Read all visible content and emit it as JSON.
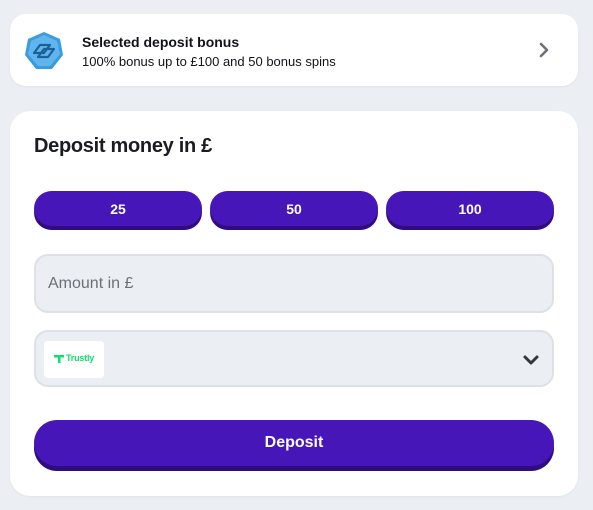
{
  "bonus": {
    "title": "Selected deposit bonus",
    "description": "100% bonus up to £100 and 50 bonus spins",
    "icon": "bonus-ticket-icon",
    "chevron_icon": "chevron-right-icon"
  },
  "deposit": {
    "title": "Deposit money in £",
    "quick_amounts": [
      "25",
      "50",
      "100"
    ],
    "amount_placeholder": "Amount in £",
    "amount_value": "",
    "payment_method": {
      "selected": "Trustly",
      "logo": "trustly-logo",
      "chevron_icon": "chevron-down-icon"
    },
    "submit_label": "Deposit"
  },
  "colors": {
    "page_background": "#ebeef2",
    "card_background": "#ffffff",
    "primary_button": "#4616b8",
    "primary_button_shadow": "#2f0c80",
    "input_background": "#ebeef2",
    "input_border": "#dde1e6",
    "bonus_icon": "#3a9be0",
    "trustly_green": "#0ee06e",
    "chevron": "#6b7079"
  }
}
